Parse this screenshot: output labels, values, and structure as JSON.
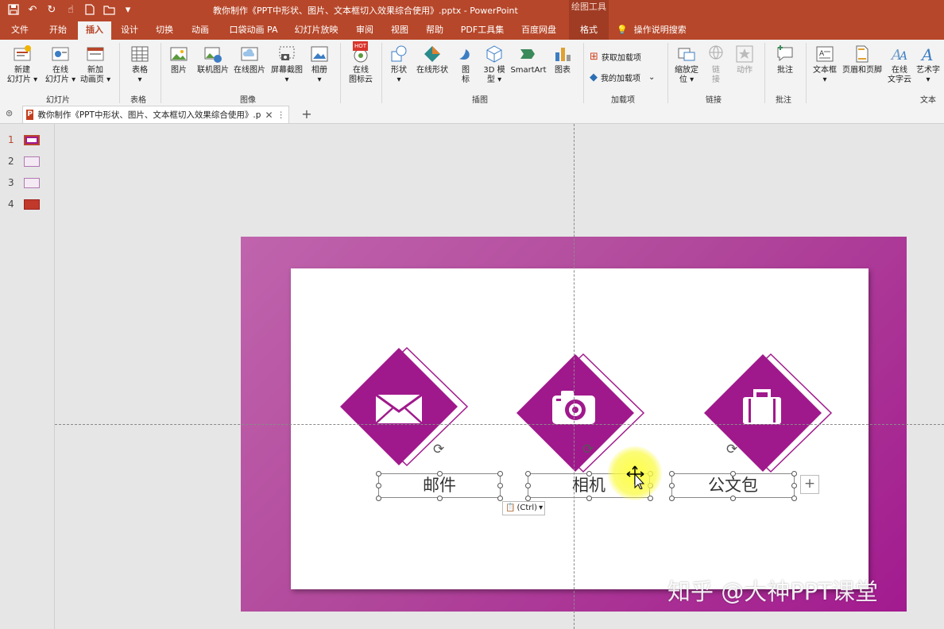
{
  "window": {
    "title": "教你制作《PPT中形状、图片、文本框切入效果综合使用》.pptx  -  PowerPoint",
    "context_group": "绘图工具"
  },
  "qat_icons": [
    "save-icon",
    "undo-icon",
    "redo-icon",
    "touch-mode-icon",
    "new-icon",
    "open-icon",
    "customize-icon"
  ],
  "tabs": [
    "文件",
    "开始",
    "插入",
    "设计",
    "切换",
    "动画",
    "口袋动画 PA",
    "幻灯片放映",
    "审阅",
    "视图",
    "帮助",
    "PDF工具集",
    "百度网盘",
    "格式"
  ],
  "active_tab": "插入",
  "tell_me": "操作说明搜索",
  "ribbon": {
    "buttons": [
      {
        "label": "新建\n幻灯片 ▾"
      },
      {
        "label": "在线\n幻灯片 ▾"
      },
      {
        "label": "新加\n动画页 ▾"
      },
      {
        "label": "表格\n▾"
      },
      {
        "label": "图片"
      },
      {
        "label": "联机图片"
      },
      {
        "label": "在线图片"
      },
      {
        "label": "屏幕截图\n▾"
      },
      {
        "label": "相册\n▾"
      },
      {
        "label": "在线\n图标云"
      },
      {
        "label": "形状\n▾"
      },
      {
        "label": "在线形状"
      },
      {
        "label": "图\n标"
      },
      {
        "label": "3D 模\n型 ▾"
      },
      {
        "label": "SmartArt"
      },
      {
        "label": "图表"
      },
      {
        "label": "缩放定\n位 ▾"
      },
      {
        "label": "链\n接"
      },
      {
        "label": "动作"
      },
      {
        "label": "批注"
      },
      {
        "label": "文本框\n▾"
      },
      {
        "label": "页眉和页脚"
      },
      {
        "label": "在线\n文字云"
      },
      {
        "label": "艺术字\n▾"
      }
    ],
    "addins": [
      "获取加载项",
      "我的加载项"
    ],
    "hot_badge": "HOT",
    "groups": [
      "幻灯片",
      "表格",
      "图像",
      "插图",
      "加载项",
      "链接",
      "批注",
      "文本"
    ]
  },
  "document_tab": {
    "name": "教你制作《PPT中形状、图片、文本框切入效果综合使用》.p",
    "close": "✕",
    "menu": "⋮",
    "new_tab": "+"
  },
  "thumbnails": [
    "1",
    "2",
    "3",
    "4"
  ],
  "selected_slide": "1",
  "slide": {
    "items": [
      {
        "label": "邮件",
        "icon": "mail-icon"
      },
      {
        "label": "相机",
        "icon": "camera-icon"
      },
      {
        "label": "公文包",
        "icon": "briefcase-icon"
      }
    ],
    "paste_options": "(Ctrl)",
    "plus": "+"
  },
  "watermark": "知乎 @大神PPT课堂",
  "colors": {
    "ribbon_red": "#b7472a",
    "slide_purple": "#a21a8f",
    "diamond": "#a0198c"
  }
}
